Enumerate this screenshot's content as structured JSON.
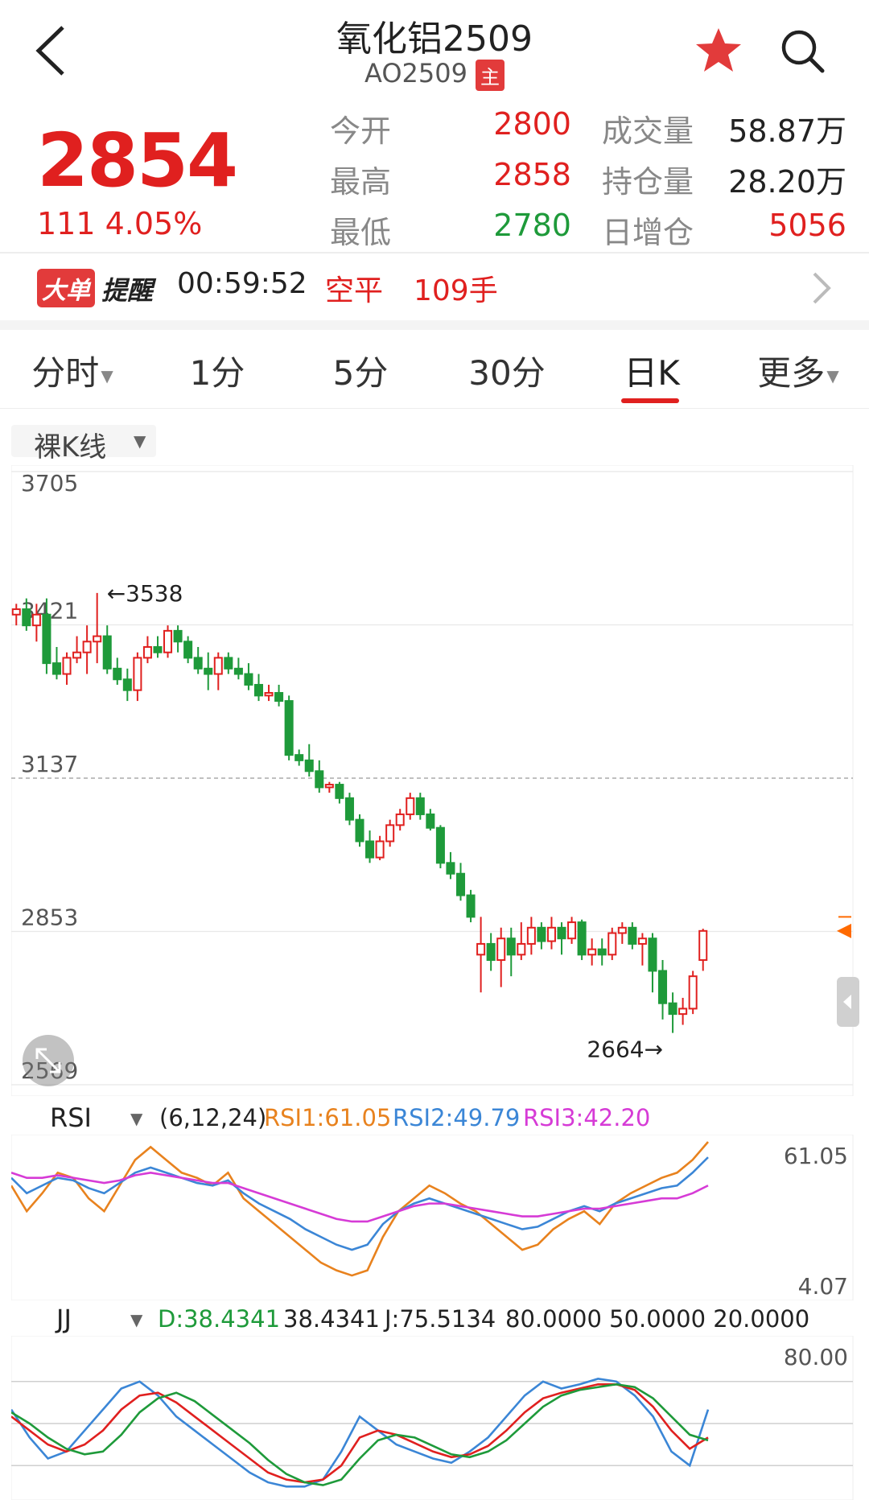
{
  "header": {
    "title": "氧化铝2509",
    "code": "AO2509",
    "badge": "主"
  },
  "quote": {
    "price": "2854",
    "change": "111  4.05%",
    "stats": [
      {
        "label": "今开",
        "value": "2800",
        "color": "#e0201f",
        "label2": "成交量",
        "value2": "58.87万",
        "color2": "#222222"
      },
      {
        "label": "最高",
        "value": "2858",
        "color": "#e0201f",
        "label2": "持仓量",
        "value2": "28.20万",
        "color2": "#222222"
      },
      {
        "label": "最低",
        "value": "2780",
        "color": "#1e9a3a",
        "label2": "日增仓",
        "value2": "5056",
        "color2": "#e0201f"
      }
    ]
  },
  "alert": {
    "badge_a": "大单",
    "badge_b": "提醒",
    "time": "00:59:52",
    "action": "空平",
    "qty": "109手"
  },
  "tabs": [
    {
      "label": "分时",
      "dropdown": true
    },
    {
      "label": "1分",
      "dropdown": false
    },
    {
      "label": "5分",
      "dropdown": false
    },
    {
      "label": "30分",
      "dropdown": false
    },
    {
      "label": "日K",
      "dropdown": false,
      "active": true
    },
    {
      "label": "更多",
      "dropdown": true
    }
  ],
  "kline_mode": "裸K线",
  "colors": {
    "up": "#e0201f",
    "down": "#1e9a3a",
    "rsi1": "#e8821e",
    "rsi2": "#3b86d6",
    "rsi3": "#d63bd6",
    "k": "#3b86d6",
    "d": "#1e9a3a",
    "j": "#e0201f"
  },
  "chart_data": [
    {
      "type": "candlestick",
      "y_axis_labels": [
        "3705",
        "3421",
        "3137",
        "2853",
        "2569"
      ],
      "ylim": [
        2569,
        3705
      ],
      "marked_high": "←3538",
      "marked_low": "2664→",
      "reference_line": 3137,
      "candles": [
        [
          3440,
          3460,
          3420,
          3450
        ],
        [
          3450,
          3470,
          3410,
          3420
        ],
        [
          3420,
          3460,
          3390,
          3440
        ],
        [
          3440,
          3470,
          3330,
          3350
        ],
        [
          3350,
          3380,
          3320,
          3330
        ],
        [
          3330,
          3370,
          3310,
          3360
        ],
        [
          3360,
          3400,
          3350,
          3370
        ],
        [
          3370,
          3420,
          3330,
          3390
        ],
        [
          3390,
          3480,
          3350,
          3400
        ],
        [
          3400,
          3420,
          3330,
          3340
        ],
        [
          3340,
          3360,
          3310,
          3320
        ],
        [
          3320,
          3340,
          3280,
          3300
        ],
        [
          3300,
          3370,
          3280,
          3360
        ],
        [
          3360,
          3400,
          3350,
          3380
        ],
        [
          3380,
          3400,
          3360,
          3370
        ],
        [
          3370,
          3420,
          3360,
          3410
        ],
        [
          3410,
          3420,
          3370,
          3390
        ],
        [
          3390,
          3400,
          3350,
          3360
        ],
        [
          3360,
          3380,
          3330,
          3340
        ],
        [
          3340,
          3370,
          3300,
          3330
        ],
        [
          3330,
          3370,
          3300,
          3360
        ],
        [
          3360,
          3370,
          3330,
          3340
        ],
        [
          3340,
          3360,
          3320,
          3330
        ],
        [
          3330,
          3350,
          3300,
          3310
        ],
        [
          3310,
          3330,
          3280,
          3290
        ],
        [
          3290,
          3310,
          3280,
          3295
        ],
        [
          3295,
          3310,
          3270,
          3280
        ],
        [
          3280,
          3290,
          3170,
          3180
        ],
        [
          3180,
          3190,
          3160,
          3170
        ],
        [
          3170,
          3200,
          3140,
          3150
        ],
        [
          3150,
          3170,
          3110,
          3120
        ],
        [
          3120,
          3130,
          3110,
          3125
        ],
        [
          3125,
          3130,
          3090,
          3100
        ],
        [
          3100,
          3110,
          3050,
          3060
        ],
        [
          3060,
          3070,
          3010,
          3020
        ],
        [
          3020,
          3040,
          2980,
          2990
        ],
        [
          2990,
          3030,
          2985,
          3020
        ],
        [
          3020,
          3060,
          3010,
          3050
        ],
        [
          3050,
          3080,
          3040,
          3070
        ],
        [
          3070,
          3110,
          3060,
          3100
        ],
        [
          3100,
          3110,
          3060,
          3070
        ],
        [
          3070,
          3080,
          3040,
          3045
        ],
        [
          3045,
          3050,
          2970,
          2980
        ],
        [
          2980,
          3000,
          2950,
          2960
        ],
        [
          2960,
          2980,
          2910,
          2920
        ],
        [
          2920,
          2930,
          2870,
          2880
        ],
        [
          2810,
          2880,
          2740,
          2830
        ],
        [
          2830,
          2850,
          2780,
          2800
        ],
        [
          2800,
          2860,
          2750,
          2840
        ],
        [
          2840,
          2860,
          2770,
          2810
        ],
        [
          2810,
          2870,
          2800,
          2830
        ],
        [
          2830,
          2880,
          2810,
          2860
        ],
        [
          2860,
          2870,
          2820,
          2835
        ],
        [
          2835,
          2880,
          2820,
          2860
        ],
        [
          2860,
          2870,
          2810,
          2840
        ],
        [
          2840,
          2880,
          2830,
          2870
        ],
        [
          2870,
          2875,
          2800,
          2810
        ],
        [
          2810,
          2840,
          2790,
          2820
        ],
        [
          2820,
          2840,
          2790,
          2810
        ],
        [
          2810,
          2860,
          2800,
          2850
        ],
        [
          2850,
          2870,
          2830,
          2860
        ],
        [
          2860,
          2870,
          2820,
          2830
        ],
        [
          2830,
          2850,
          2790,
          2840
        ],
        [
          2840,
          2850,
          2740,
          2780
        ],
        [
          2780,
          2800,
          2690,
          2720
        ],
        [
          2720,
          2740,
          2665,
          2700
        ],
        [
          2700,
          2730,
          2680,
          2710
        ],
        [
          2710,
          2780,
          2700,
          2770
        ],
        [
          2800,
          2858,
          2780,
          2854
        ]
      ]
    },
    {
      "type": "line",
      "name": "RSI",
      "params": "(6,12,24)",
      "rsi1_label": "RSI1:61.05",
      "rsi2_label": "RSI2:49.79",
      "rsi3_label": "RSI3:42.20",
      "y_top_label": "61.05",
      "y_bottom_label": "4.07",
      "ylim": [
        4.07,
        61.05
      ],
      "series": [
        {
          "values": [
            45,
            35,
            42,
            50,
            48,
            40,
            35,
            45,
            55,
            60,
            55,
            50,
            48,
            45,
            50,
            40,
            35,
            30,
            25,
            20,
            15,
            12,
            10,
            12,
            25,
            35,
            40,
            45,
            42,
            38,
            35,
            30,
            25,
            20,
            22,
            28,
            32,
            35,
            30,
            38,
            42,
            45,
            48,
            50,
            55,
            62
          ]
        },
        {
          "values": [
            48,
            42,
            45,
            48,
            47,
            44,
            42,
            46,
            50,
            52,
            50,
            48,
            46,
            45,
            47,
            42,
            38,
            35,
            32,
            28,
            25,
            22,
            20,
            22,
            30,
            35,
            38,
            40,
            38,
            36,
            34,
            32,
            30,
            28,
            29,
            32,
            35,
            37,
            35,
            38,
            40,
            42,
            44,
            45,
            50,
            56
          ]
        },
        {
          "values": [
            50,
            48,
            48,
            49,
            48,
            47,
            46,
            47,
            49,
            50,
            49,
            48,
            47,
            46,
            46,
            44,
            42,
            40,
            38,
            36,
            34,
            32,
            31,
            31,
            33,
            35,
            37,
            38,
            38,
            37,
            36,
            35,
            34,
            33,
            33,
            34,
            35,
            36,
            36,
            37,
            38,
            39,
            40,
            40,
            42,
            45
          ]
        }
      ]
    },
    {
      "type": "line",
      "name": "JJ",
      "d_label": "D:38.4341",
      "d_value": "38.4341",
      "j_label": "J:75.5134",
      "levels_text": "80.0000 50.0000 20.0000",
      "y_top_label": "80.00",
      "ylim": [
        0,
        100
      ],
      "levels": [
        80,
        50,
        20
      ],
      "series": [
        {
          "values": [
            60,
            40,
            25,
            30,
            45,
            60,
            75,
            80,
            70,
            55,
            45,
            35,
            25,
            15,
            8,
            5,
            5,
            10,
            30,
            55,
            45,
            35,
            30,
            25,
            22,
            30,
            40,
            55,
            70,
            80,
            75,
            78,
            82,
            80,
            70,
            55,
            30,
            20,
            60
          ]
        },
        {
          "values": [
            55,
            45,
            35,
            30,
            35,
            45,
            60,
            70,
            72,
            65,
            55,
            45,
            35,
            25,
            15,
            10,
            8,
            10,
            20,
            40,
            45,
            42,
            36,
            30,
            26,
            28,
            34,
            45,
            58,
            68,
            72,
            75,
            78,
            78,
            74,
            62,
            45,
            32,
            40
          ]
        },
        {
          "values": [
            58,
            50,
            40,
            32,
            28,
            30,
            42,
            58,
            68,
            72,
            66,
            56,
            46,
            36,
            24,
            14,
            8,
            6,
            10,
            25,
            38,
            42,
            40,
            34,
            28,
            26,
            30,
            38,
            50,
            62,
            70,
            74,
            76,
            78,
            76,
            68,
            55,
            42,
            38
          ]
        }
      ]
    }
  ]
}
